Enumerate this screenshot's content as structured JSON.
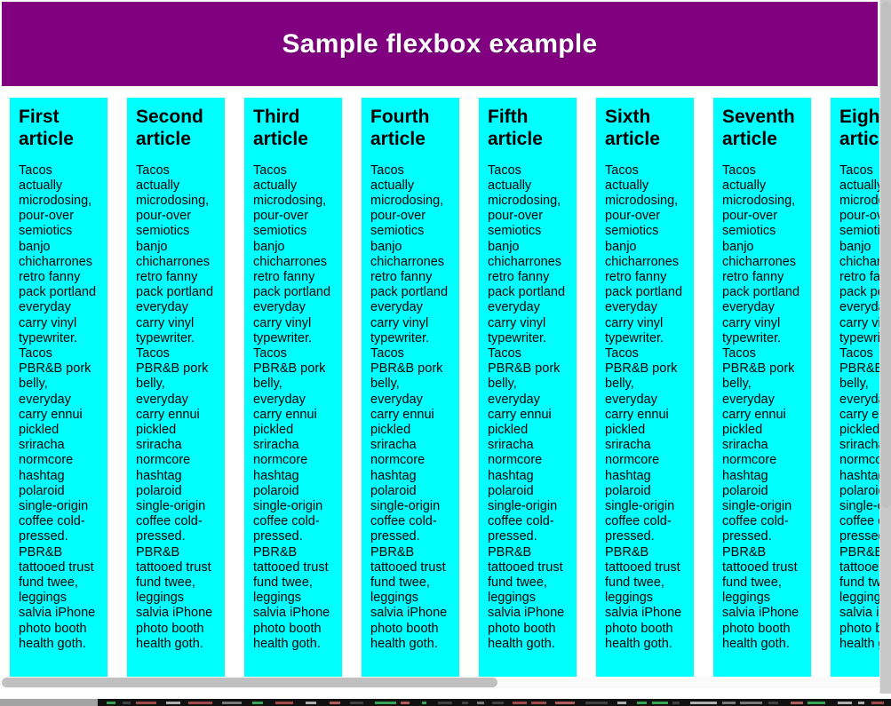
{
  "header": {
    "title": "Sample flexbox example",
    "background_color": "#800080",
    "text_color": "#ffffff"
  },
  "articles": {
    "background_color": "#00ffff",
    "text_color": "#000000",
    "body_text": "Tacos actually microdosing, pour-over semiotics banjo chicharrones retro fanny pack portland everyday carry vinyl typewriter. Tacos PBR&B pork belly, everyday carry ennui pickled sriracha normcore hashtag polaroid single-origin coffee cold-pressed. PBR&B tattooed trust fund twee, leggings salvia iPhone photo booth health goth.",
    "items": [
      {
        "heading": "First article"
      },
      {
        "heading": "Second article"
      },
      {
        "heading": "Third article"
      },
      {
        "heading": "Fourth article"
      },
      {
        "heading": "Fifth article"
      },
      {
        "heading": "Sixth article"
      },
      {
        "heading": "Seventh article"
      },
      {
        "heading": "Eighth article"
      }
    ]
  },
  "scrollbars": {
    "vertical_present": true,
    "horizontal_present": true,
    "thumb_color": "#c0c0c0",
    "track_color": "#c8c8c8"
  }
}
